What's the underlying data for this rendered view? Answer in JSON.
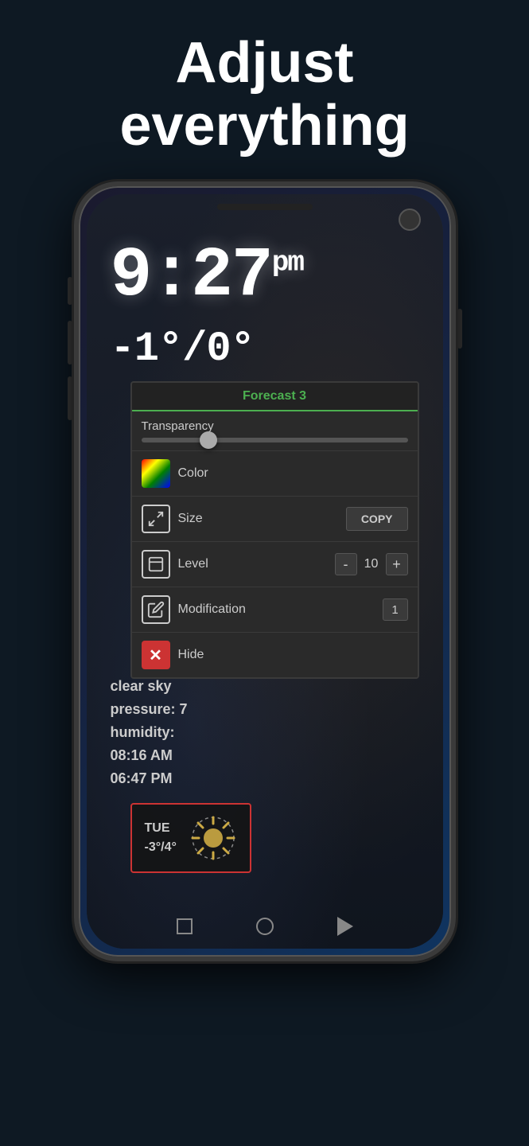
{
  "header": {
    "line1": "Adjust",
    "line2": "everything"
  },
  "phone": {
    "time": "9:27",
    "ampm": "pm",
    "temp_range": "-1°/0°",
    "weather": {
      "condition": "clear sky",
      "pressure": "pressure: 7",
      "humidity": "humidity:",
      "sunrise": "08:16 AM",
      "sunset": "06:47 PM"
    }
  },
  "popup": {
    "title": "Forecast 3",
    "transparency_label": "Transparency",
    "color_label": "Color",
    "size_label": "Size",
    "copy_label": "COPY",
    "level_label": "Level",
    "level_minus": "-",
    "level_value": "10",
    "level_plus": "+",
    "modification_label": "Modification",
    "modification_value": "1",
    "hide_label": "Hide"
  },
  "forecast_widget": {
    "day": "TUE",
    "temp": "-3°/4°"
  },
  "nav": {
    "square": "□",
    "circle": "○",
    "triangle": "▷"
  }
}
